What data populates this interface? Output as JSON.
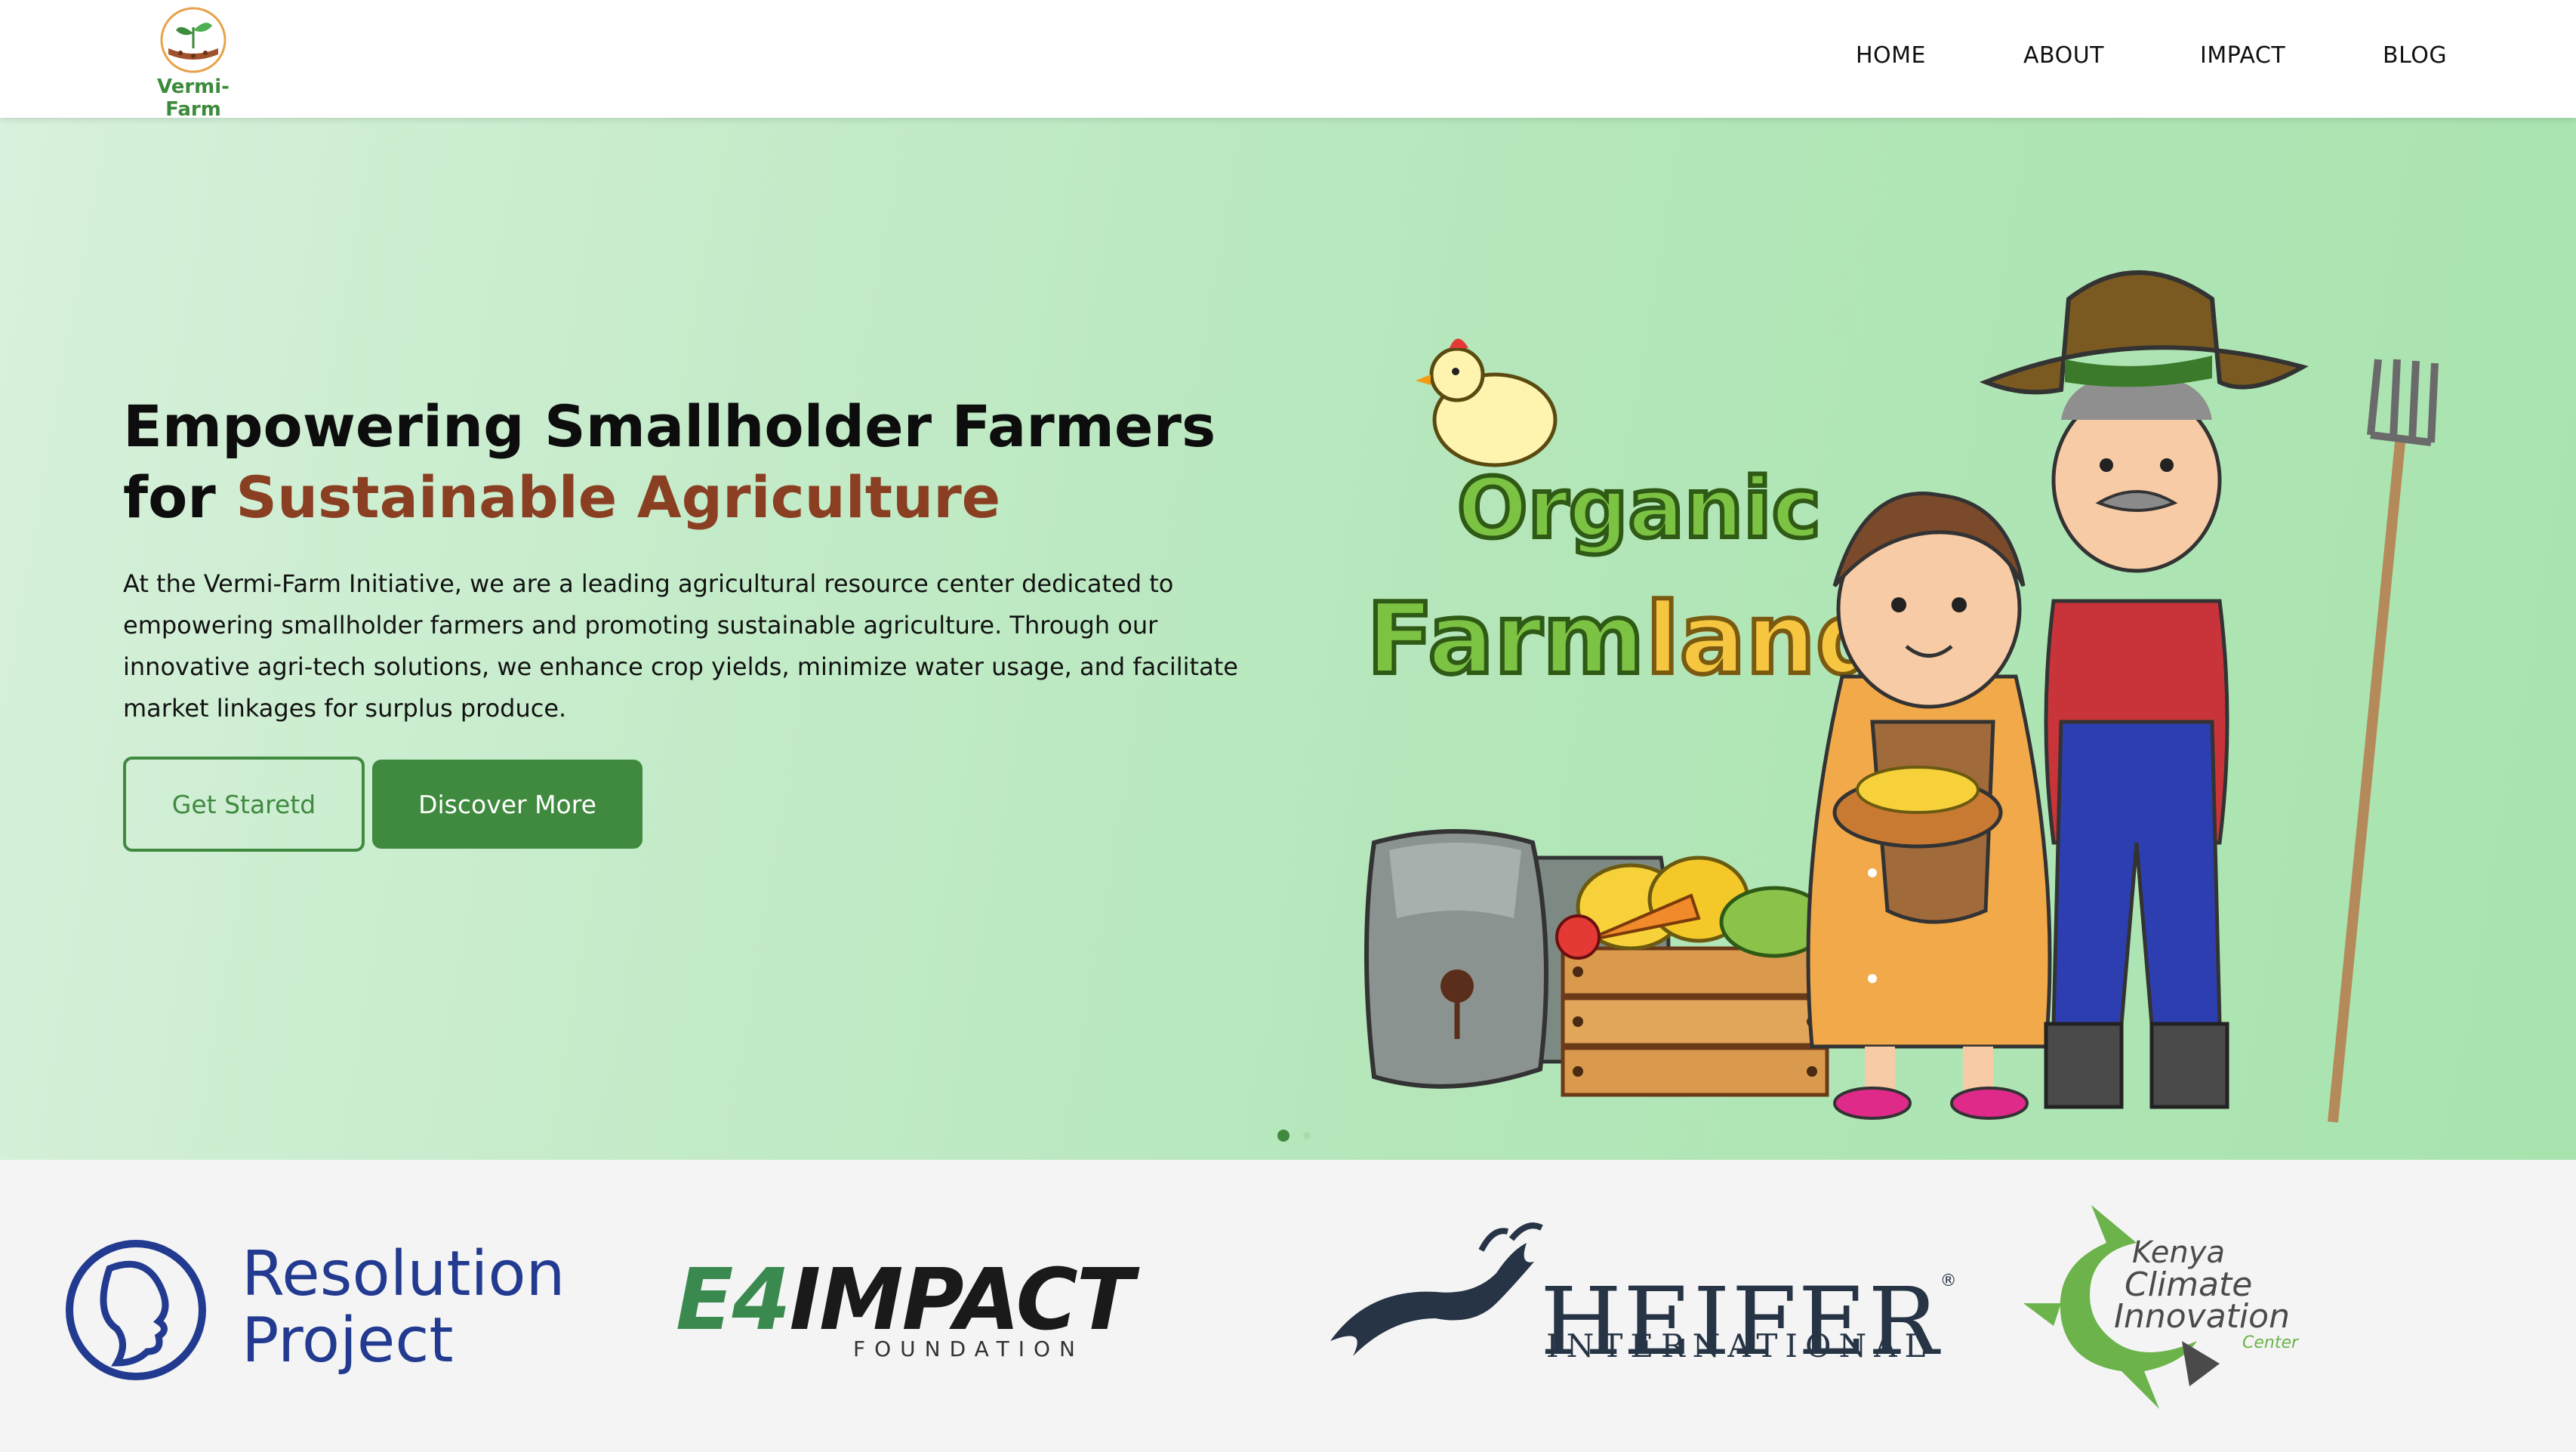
{
  "brand": {
    "name": "Vermi-Farm",
    "colors": {
      "primary_green": "#3f8a3f",
      "accent_brown": "#8a3f22",
      "hero_bg": "#b3e6b9"
    }
  },
  "nav": {
    "items": [
      {
        "label": "HOME"
      },
      {
        "label": "ABOUT"
      },
      {
        "label": "IMPACT"
      },
      {
        "label": "BLOG"
      }
    ]
  },
  "hero": {
    "title_line1": "Empowering Smallholder Farmers",
    "title_line2_prefix": "for ",
    "title_line2_accent": "Sustainable Agriculture",
    "description": "At the Vermi-Farm Initiative, we are a leading agricultural resource center dedicated to empowering smallholder farmers and promoting sustainable agriculture. Through our innovative agri-tech solutions, we enhance crop yields, minimize water usage, and facilitate market linkages for surplus produce.",
    "buttons": {
      "primary_outline": "Get Staretd",
      "secondary_solid": "Discover More"
    },
    "illustration": {
      "sign_line1": "Organic",
      "sign_line2a": "Farm",
      "sign_line2b": "land"
    },
    "carousel": {
      "slides": 2,
      "active": 1
    }
  },
  "partners": {
    "resolution": {
      "line1": "Resolution",
      "line2": "Project"
    },
    "e4impact": {
      "e4": "E4",
      "impact": "IMPACT",
      "sub": "FOUNDATION"
    },
    "heifer": {
      "name": "HEIFER",
      "sub": "INTERNATIONAL",
      "reg": "®"
    },
    "kcic": {
      "line1": "Kenya",
      "line2": "Climate",
      "line3": "Innovation",
      "line4": "Center"
    }
  }
}
